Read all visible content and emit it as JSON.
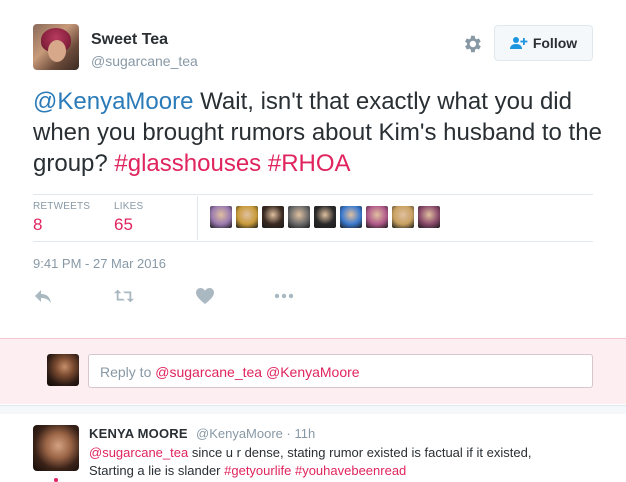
{
  "tweet": {
    "author_name": "Sweet Tea",
    "author_handle": "@sugarcane_tea",
    "follow_label": "Follow",
    "mention": "@KenyaMoore",
    "text_main": " Wait, isn't that exactly what you did when you brought rumors about Kim's husband to the group? ",
    "hashtag1": "#glasshouses",
    "hashtag2": "#RHOA",
    "retweets_label": "RETWEETS",
    "retweets_count": "8",
    "likes_label": "LIKES",
    "likes_count": "65",
    "timestamp": "9:41 PM - 27 Mar 2016",
    "liker_avatar_colors": [
      "#9a7ab0",
      "#c89a3a",
      "#3a2a22",
      "#6a6a6a",
      "#2a2a2a",
      "#3a7ad0",
      "#b05a8a",
      "#c8a060",
      "#8a4a6a"
    ]
  },
  "reply_box": {
    "prefix": "Reply to ",
    "mention1": "@sugarcane_tea",
    "mention2": "@KenyaMoore"
  },
  "reply_tweet": {
    "author_name": "KENYA MOORE",
    "meta": "@KenyaMoore · 11h",
    "mention": "@sugarcane_tea",
    "text_line1": " since u r dense, stating rumor existed is factual if it existed,",
    "text_line2": "Starting a lie is slander ",
    "hashtag1": "#getyourlife",
    "hashtag2": "#youhavebeenread"
  },
  "colors": {
    "accent_red": "#e0245e",
    "link_blue": "#2b7bb9",
    "muted": "#8899a6"
  }
}
